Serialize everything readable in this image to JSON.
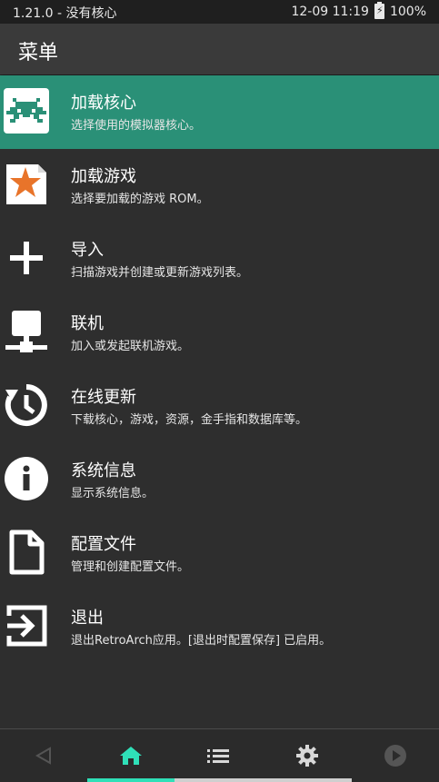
{
  "status_bar": {
    "left_text": "1.21.0 - 没有核心",
    "time": "12-09 11:19",
    "battery": "100%"
  },
  "header": {
    "title": "菜单"
  },
  "menu": {
    "items": [
      {
        "label": "加载核心",
        "description": "选择使用的模拟器核心。",
        "icon": "retroarch-invader-icon",
        "selected": true
      },
      {
        "label": "加载游戏",
        "description": "选择要加载的游戏 ROM。",
        "icon": "star-file-icon"
      },
      {
        "label": "导入",
        "description": "扫描游戏并创建或更新游戏列表。",
        "icon": "plus-icon"
      },
      {
        "label": "联机",
        "description": "加入或发起联机游戏。",
        "icon": "network-icon"
      },
      {
        "label": "在线更新",
        "description": "下载核心，游戏，资源，金手指和数据库等。",
        "icon": "update-clock-icon"
      },
      {
        "label": "系统信息",
        "description": "显示系统信息。",
        "icon": "info-icon"
      },
      {
        "label": "配置文件",
        "description": "管理和创建配置文件。",
        "icon": "file-icon"
      },
      {
        "label": "退出",
        "description": "退出RetroArch应用。[退出时配置保存] 已启用。",
        "icon": "exit-icon"
      }
    ]
  },
  "bottom_nav": {
    "tabs": [
      "back-icon",
      "home-icon",
      "list-icon",
      "settings-icon",
      "play-icon"
    ],
    "active_tab": "home-icon"
  },
  "colors": {
    "accent": "#2a9077",
    "indicator": "#2fe0b8",
    "background": "#2e2e2e"
  }
}
